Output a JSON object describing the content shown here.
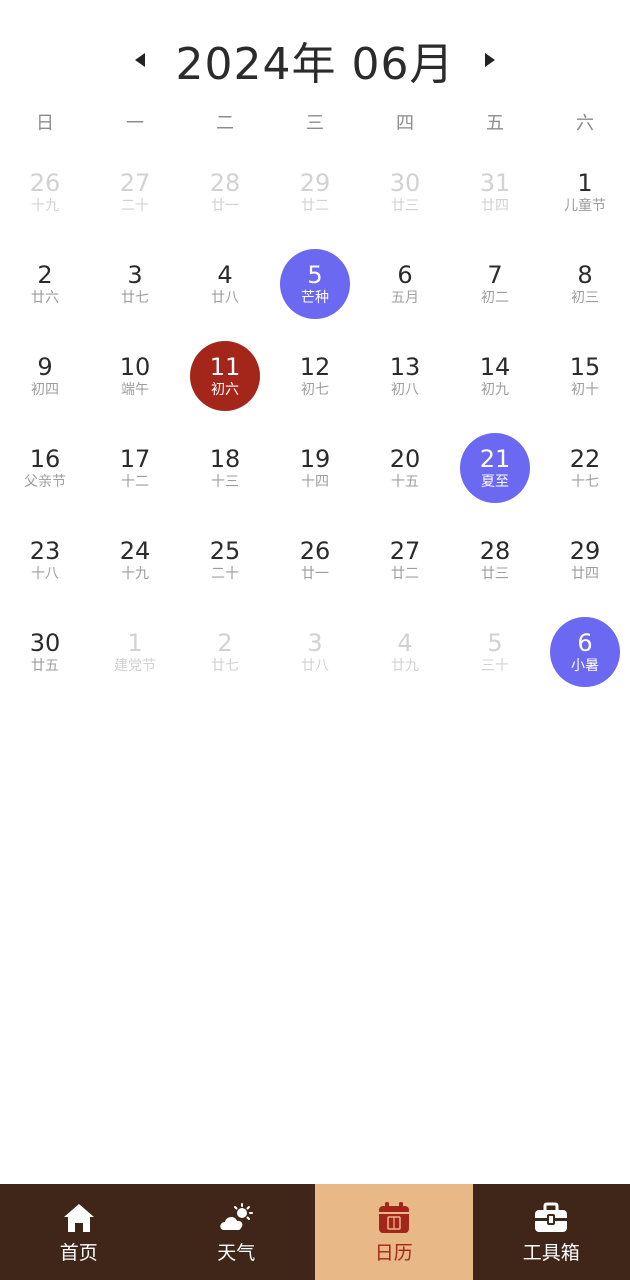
{
  "header": {
    "title": "2024年 06月",
    "prev_icon": "caret-left-icon",
    "next_icon": "caret-right-icon"
  },
  "weekdays": [
    "日",
    "一",
    "二",
    "三",
    "四",
    "五",
    "六"
  ],
  "calendar": {
    "days": [
      {
        "day": "26",
        "lunar": "十九",
        "state": "other"
      },
      {
        "day": "27",
        "lunar": "二十",
        "state": "other"
      },
      {
        "day": "28",
        "lunar": "廿一",
        "state": "other"
      },
      {
        "day": "29",
        "lunar": "廿二",
        "state": "other"
      },
      {
        "day": "30",
        "lunar": "廿三",
        "state": "other"
      },
      {
        "day": "31",
        "lunar": "廿四",
        "state": "other"
      },
      {
        "day": "1",
        "lunar": "儿童节",
        "state": "current"
      },
      {
        "day": "2",
        "lunar": "廿六",
        "state": "current"
      },
      {
        "day": "3",
        "lunar": "廿七",
        "state": "current"
      },
      {
        "day": "4",
        "lunar": "廿八",
        "state": "current"
      },
      {
        "day": "5",
        "lunar": "芒种",
        "state": "solar"
      },
      {
        "day": "6",
        "lunar": "五月",
        "state": "current"
      },
      {
        "day": "7",
        "lunar": "初二",
        "state": "current"
      },
      {
        "day": "8",
        "lunar": "初三",
        "state": "current"
      },
      {
        "day": "9",
        "lunar": "初四",
        "state": "current"
      },
      {
        "day": "10",
        "lunar": "端午",
        "state": "current"
      },
      {
        "day": "11",
        "lunar": "初六",
        "state": "selected"
      },
      {
        "day": "12",
        "lunar": "初七",
        "state": "current"
      },
      {
        "day": "13",
        "lunar": "初八",
        "state": "current"
      },
      {
        "day": "14",
        "lunar": "初九",
        "state": "current"
      },
      {
        "day": "15",
        "lunar": "初十",
        "state": "current"
      },
      {
        "day": "16",
        "lunar": "父亲节",
        "state": "current"
      },
      {
        "day": "17",
        "lunar": "十二",
        "state": "current"
      },
      {
        "day": "18",
        "lunar": "十三",
        "state": "current"
      },
      {
        "day": "19",
        "lunar": "十四",
        "state": "current"
      },
      {
        "day": "20",
        "lunar": "十五",
        "state": "current"
      },
      {
        "day": "21",
        "lunar": "夏至",
        "state": "solar"
      },
      {
        "day": "22",
        "lunar": "十七",
        "state": "current"
      },
      {
        "day": "23",
        "lunar": "十八",
        "state": "current"
      },
      {
        "day": "24",
        "lunar": "十九",
        "state": "current"
      },
      {
        "day": "25",
        "lunar": "二十",
        "state": "current"
      },
      {
        "day": "26",
        "lunar": "廿一",
        "state": "current"
      },
      {
        "day": "27",
        "lunar": "廿二",
        "state": "current"
      },
      {
        "day": "28",
        "lunar": "廿三",
        "state": "current"
      },
      {
        "day": "29",
        "lunar": "廿四",
        "state": "current"
      },
      {
        "day": "30",
        "lunar": "廿五",
        "state": "current"
      },
      {
        "day": "1",
        "lunar": "建党节",
        "state": "other"
      },
      {
        "day": "2",
        "lunar": "廿七",
        "state": "other"
      },
      {
        "day": "3",
        "lunar": "廿八",
        "state": "other"
      },
      {
        "day": "4",
        "lunar": "廿九",
        "state": "other"
      },
      {
        "day": "5",
        "lunar": "三十",
        "state": "other"
      },
      {
        "day": "6",
        "lunar": "小暑",
        "state": "solar"
      }
    ]
  },
  "tabbar": {
    "tabs": [
      {
        "label": "首页",
        "icon": "home-icon",
        "active": false
      },
      {
        "label": "天气",
        "icon": "weather-icon",
        "active": false
      },
      {
        "label": "日历",
        "icon": "calendar-icon",
        "active": true
      },
      {
        "label": "工具箱",
        "icon": "toolbox-icon",
        "active": false
      }
    ]
  },
  "colors": {
    "solar_term": "#6b68f1",
    "selected": "#a4261a",
    "tabbar_bg": "#3f2618",
    "tabbar_active_bg": "#e9b887"
  }
}
